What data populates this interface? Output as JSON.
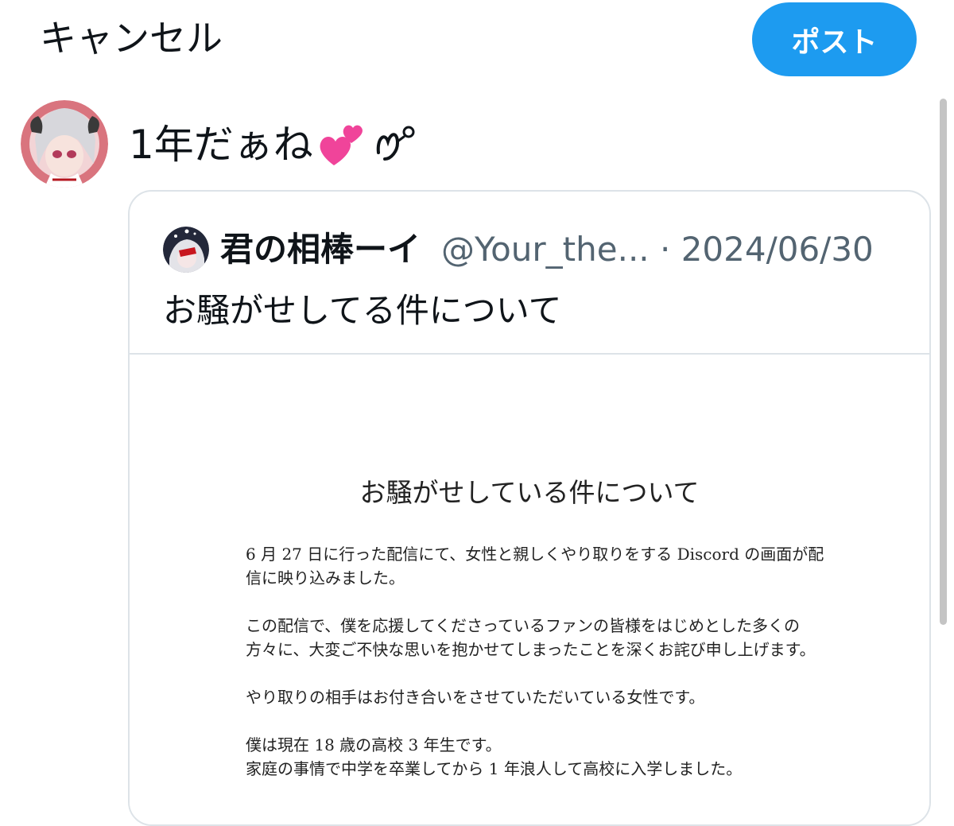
{
  "header": {
    "cancel_label": "キャンセル",
    "post_label": "ポスト"
  },
  "compose": {
    "text": "1年だぁね",
    "emoji": "💕ᙏ̤̫"
  },
  "quote": {
    "display_name": "君の相棒ーイ",
    "handle_date": "@Your_the... · 2024/06/30",
    "text": "お騒がせしてる件について"
  },
  "document": {
    "title": "お騒がせしている件について",
    "paragraphs": [
      "6 月 27 日に行った配信にて、女性と親しくやり取りをする Discord の画面が配\n信に映り込みました。",
      "この配信で、僕を応援してくださっているファンの皆様をはじめとした多くの\n方々に、大変ご不快な思いを抱かせてしまったことを深くお詫び申し上げます。",
      "やり取りの相手はお付き合いをさせていただいている女性です。",
      "僕は現在 18 歳の高校 3 年生です。\n家庭の事情で中学を卒業してから 1 年浪人して高校に入学しました。"
    ]
  },
  "colors": {
    "accent": "#1d9bf0",
    "text": "#0f1419",
    "muted": "#536471",
    "border": "#dde3e8"
  }
}
